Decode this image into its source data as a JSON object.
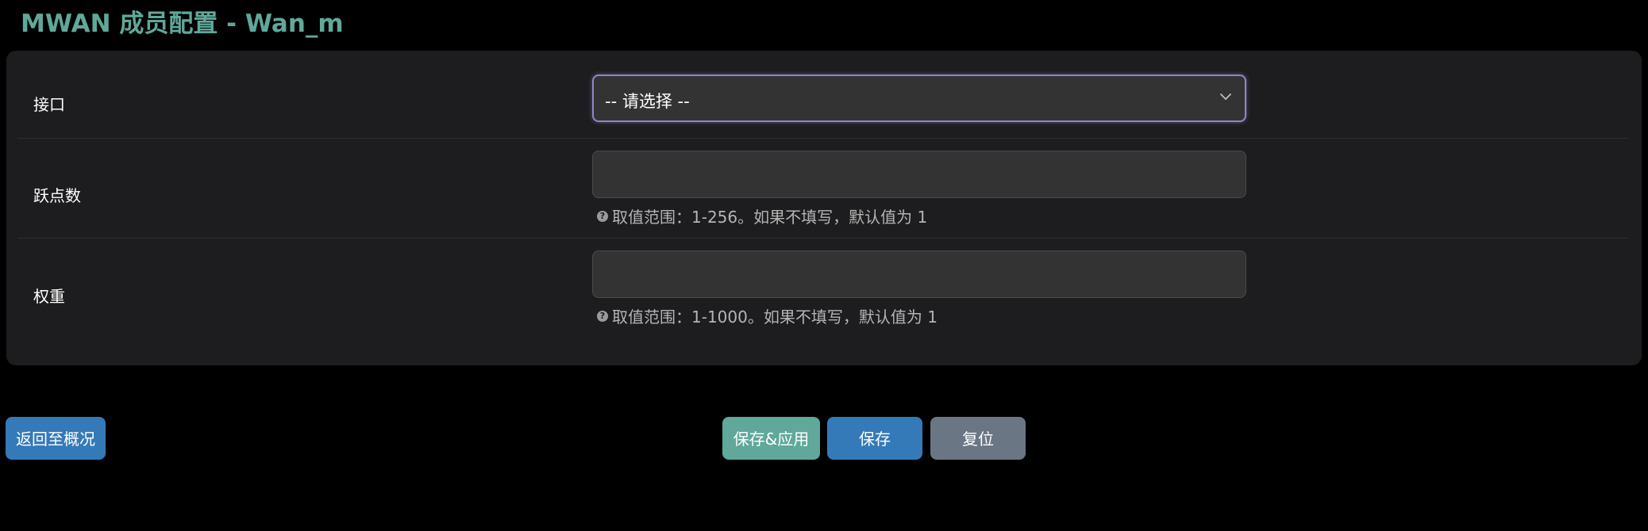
{
  "page": {
    "title": "MWAN 成员配置 - Wan_m"
  },
  "form": {
    "interface": {
      "label": "接口",
      "selected": "-- 请选择 --"
    },
    "metric": {
      "label": "跃点数",
      "value": "",
      "hint": "取值范围：1-256。如果不填写，默认值为 1"
    },
    "weight": {
      "label": "权重",
      "value": "",
      "hint": "取值范围：1-1000。如果不填写，默认值为 1"
    },
    "hint_icon": "question-circle-icon",
    "select_icon": "chevron-down-icon"
  },
  "actions": {
    "back_label": "返回至概况",
    "save_apply_label": "保存&应用",
    "save_label": "保存",
    "reset_label": "复位"
  },
  "colors": {
    "title": "#5fa89a",
    "card_bg": "#1d1d1f",
    "field_bg": "#333333",
    "focus_border": "#8e86c8",
    "btn_primary": "#357ab8",
    "btn_apply": "#5fa89a",
    "btn_reset": "#6b7684"
  }
}
